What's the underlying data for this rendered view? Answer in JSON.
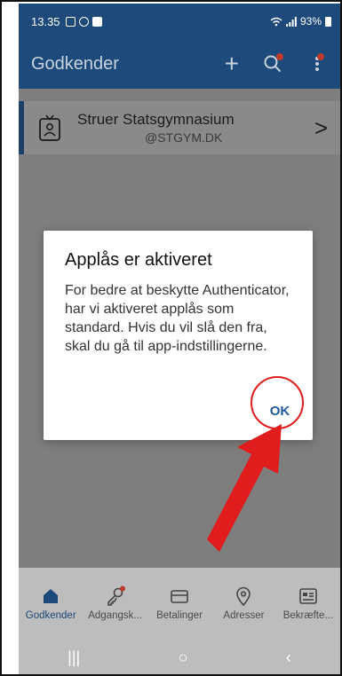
{
  "status_bar": {
    "time": "13.35",
    "battery": "93%",
    "icons": [
      "gallery-icon",
      "whatsapp-icon",
      "check-icon",
      "wifi-icon",
      "signal-icon",
      "battery-icon"
    ]
  },
  "app_bar": {
    "title": "Godkender",
    "add_icon": "plus-icon",
    "search_icon": "search-icon",
    "menu_icon": "more-vert-icon"
  },
  "account": {
    "organization": "Struer Statsgymnasium",
    "username": "@STGYM.DK",
    "icon": "badge-icon"
  },
  "dialog": {
    "title": "Applås er aktiveret",
    "body": "For bedre at beskytte Authenticator, har vi aktiveret applås som standard. Hvis du vil slå den fra, skal du gå til app-indstillingerne.",
    "ok_label": "OK"
  },
  "bottom_nav": {
    "items": [
      {
        "label": "Godkender",
        "icon": "home-icon",
        "active": true
      },
      {
        "label": "Adgangsk...",
        "icon": "key-icon",
        "active": false
      },
      {
        "label": "Betalinger",
        "icon": "card-icon",
        "active": false
      },
      {
        "label": "Adresser",
        "icon": "location-icon",
        "active": false
      },
      {
        "label": "Bekræfte...",
        "icon": "id-card-icon",
        "active": false
      }
    ]
  },
  "system_nav": {
    "recents": "|||",
    "home": "○",
    "back": "‹"
  },
  "colors": {
    "primary": "#1d4a7a",
    "annotation_red": "#e01c1c",
    "ok_blue": "#1e5aa0"
  }
}
